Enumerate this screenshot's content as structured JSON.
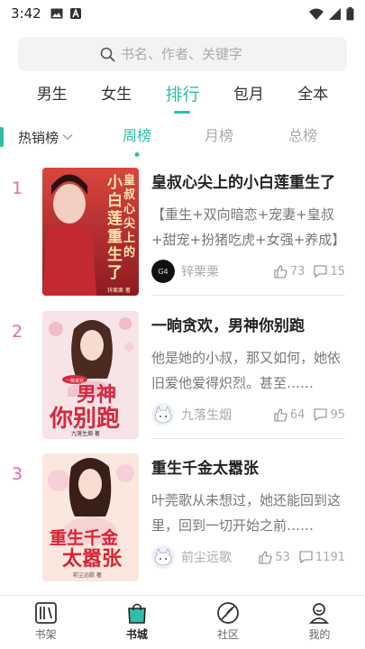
{
  "status_bar": {
    "time": "3:42"
  },
  "search": {
    "placeholder": "书名、作者、关键字"
  },
  "top_tabs": [
    {
      "label": "男生",
      "active": false
    },
    {
      "label": "女生",
      "active": false
    },
    {
      "label": "排行",
      "active": true
    },
    {
      "label": "包月",
      "active": false
    },
    {
      "label": "全本",
      "active": false
    }
  ],
  "sub_tabs": {
    "dropdown_label": "热销榜",
    "items": [
      {
        "label": "周榜",
        "active": true
      },
      {
        "label": "月榜",
        "active": false
      },
      {
        "label": "总榜",
        "active": false
      }
    ]
  },
  "books": [
    {
      "rank": "1",
      "title": "皇叔心尖上的小白莲重生了",
      "description": "【重生+双向暗恋+宠妻+皇叔+甜宠+扮猪吃虎+女强+养成】",
      "author": "锌栗栗",
      "likes": "73",
      "comments": "15",
      "cover_text": "重生了皇叔心尖上的小白莲",
      "cover_caption": "锌栗栗 著",
      "avatar_text": "G4",
      "cover_color": "#b8202a"
    },
    {
      "rank": "2",
      "title": "一晌贪欢，男神你别跑",
      "description": "他是她的小叔，那又如何，她依旧爱他爱得炽烈。甚至……",
      "author": "九落生烟",
      "likes": "64",
      "comments": "95",
      "cover_text": "男神你别跑",
      "cover_caption": "九落生烟 著",
      "avatar_text": "",
      "cover_color": "#f7e2e6"
    },
    {
      "rank": "3",
      "title": "重生千金太嚣张",
      "description": "叶莞歌从未想过，她还能回到这里，回到一切开始之前……",
      "author": "前尘远歌",
      "likes": "53",
      "comments": "1191",
      "cover_text": "重生千金太嚣张",
      "cover_caption": "前尘远歌 著",
      "avatar_text": "",
      "cover_color": "#fbe6dc"
    }
  ],
  "bottom_nav": [
    {
      "label": "书架",
      "icon": "bookshelf-icon",
      "active": false
    },
    {
      "label": "书城",
      "icon": "bookstore-bag-icon",
      "active": true
    },
    {
      "label": "社区",
      "icon": "community-icon",
      "active": false
    },
    {
      "label": "我的",
      "icon": "profile-icon",
      "active": false
    }
  ],
  "colors": {
    "accent": "#2fbfa6",
    "rank": "#e86aa6"
  }
}
